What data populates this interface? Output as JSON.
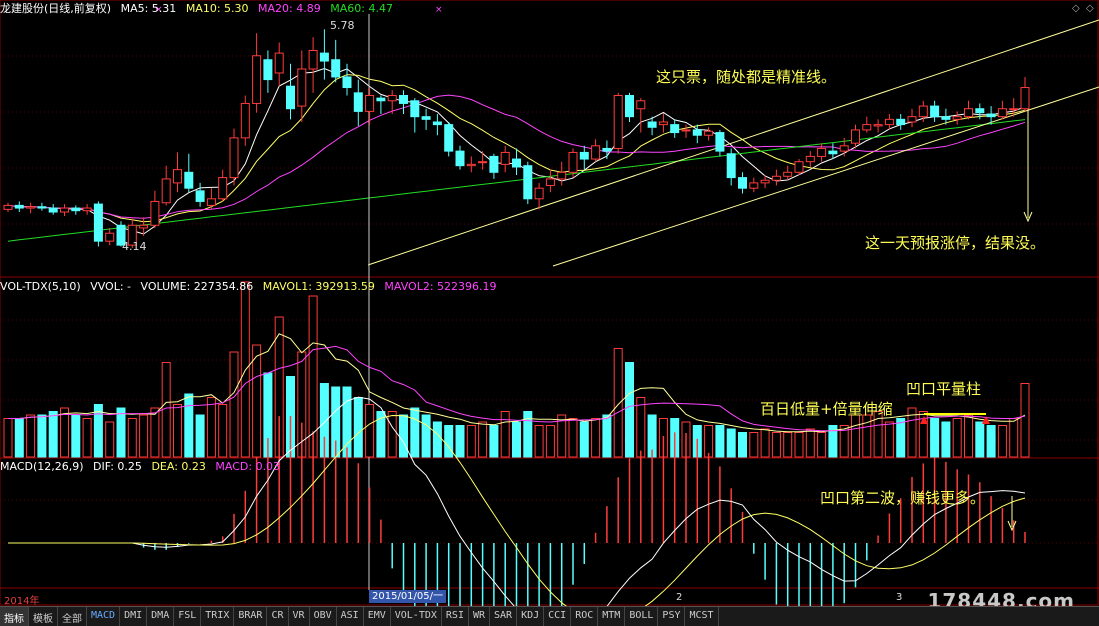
{
  "header": {
    "title": "龙建股份(日线,前复权)",
    "ma5": "MA5: 5.31",
    "ma10": "MA10: 5.30",
    "ma20": "MA20: 4.89",
    "ma60": "MA60: 4.47"
  },
  "volume_header": {
    "name": "VOL-TDX(5,10)",
    "vvol": "VVOL: -",
    "volume": "VOLUME: 227354.86",
    "mavol1": "MAVOL1: 392913.59",
    "mavol2": "MAVOL2: 522396.19"
  },
  "macd_header": {
    "name": "MACD(12,26,9)",
    "dif": "DIF: 0.25",
    "dea": "DEA: 0.23",
    "macd": "MACD: 0.03"
  },
  "annotations": {
    "note1": "这只票，随处都是精准线。",
    "note2": "这一天预报涨停，结果没。",
    "note3": "百日低量+倍量伸缩",
    "note4": "凹口平量柱",
    "note5": "凹口第二波，赚钱更多。",
    "high_label": "5.78",
    "low_label": "4.14"
  },
  "timeline": {
    "year": "2014年",
    "cursor_date": "2015/01/05/一",
    "m2": "2",
    "m3": "3"
  },
  "watermark": "178448.com",
  "tabs": [
    "指标",
    "模板",
    "全部",
    "MACD",
    "DMI",
    "DMA",
    "FSL",
    "TRIX",
    "BRAR",
    "CR",
    "VR",
    "OBV",
    "ASI",
    "EMV",
    "VOL-TDX",
    "RSI",
    "WR",
    "SAR",
    "KDJ",
    "CCI",
    "ROC",
    "MTM",
    "BOLL",
    "PSY",
    "MCST"
  ],
  "colors": {
    "up": "#ff3c3c",
    "down": "#54ffff",
    "ma5": "#ffffff",
    "ma10": "#ffff66",
    "ma20": "#ff44ff",
    "ma60": "#22dd22",
    "trendline": "#ffff99"
  },
  "chart_data": {
    "type": "candlestick",
    "units": "price (CNY)",
    "candles": [
      [
        4.42,
        4.45,
        4.47,
        4.4
      ],
      [
        4.45,
        4.43,
        4.48,
        4.4
      ],
      [
        4.43,
        4.44,
        4.47,
        4.39
      ],
      [
        4.44,
        4.43,
        4.47,
        4.41
      ],
      [
        4.43,
        4.4,
        4.46,
        4.38
      ],
      [
        4.4,
        4.43,
        4.46,
        4.37
      ],
      [
        4.43,
        4.41,
        4.45,
        4.38
      ],
      [
        4.41,
        4.43,
        4.46,
        4.38
      ],
      [
        4.46,
        4.18,
        4.48,
        4.14
      ],
      [
        4.18,
        4.24,
        4.28,
        4.15
      ],
      [
        4.3,
        4.15,
        4.33,
        4.14
      ],
      [
        4.15,
        4.3,
        4.35,
        4.13
      ],
      [
        4.28,
        4.3,
        4.36,
        4.22
      ],
      [
        4.3,
        4.48,
        4.56,
        4.28
      ],
      [
        4.47,
        4.65,
        4.75,
        4.45
      ],
      [
        4.62,
        4.72,
        4.85,
        4.55
      ],
      [
        4.7,
        4.58,
        4.84,
        4.55
      ],
      [
        4.56,
        4.48,
        4.62,
        4.44
      ],
      [
        4.45,
        4.5,
        4.58,
        4.42
      ],
      [
        4.5,
        4.66,
        4.72,
        4.48
      ],
      [
        4.66,
        4.96,
        5.03,
        4.6
      ],
      [
        4.96,
        5.22,
        5.28,
        4.9
      ],
      [
        5.22,
        5.58,
        5.75,
        5.15
      ],
      [
        5.55,
        5.4,
        5.62,
        5.3
      ],
      [
        5.45,
        5.6,
        5.68,
        5.35
      ],
      [
        5.35,
        5.18,
        5.52,
        5.1
      ],
      [
        5.2,
        5.48,
        5.62,
        5.08
      ],
      [
        5.48,
        5.62,
        5.72,
        5.3
      ],
      [
        5.6,
        5.54,
        5.78,
        5.4
      ],
      [
        5.55,
        5.42,
        5.7,
        5.38
      ],
      [
        5.42,
        5.34,
        5.52,
        5.28
      ],
      [
        5.3,
        5.16,
        5.4,
        5.05
      ],
      [
        5.16,
        5.28,
        5.34,
        5.06
      ],
      [
        5.26,
        5.24,
        5.28,
        5.14
      ],
      [
        5.24,
        5.28,
        5.32,
        5.14
      ],
      [
        5.28,
        5.22,
        5.32,
        5.14
      ],
      [
        5.24,
        5.12,
        5.26,
        5.0
      ],
      [
        5.12,
        5.1,
        5.18,
        5.02
      ],
      [
        5.08,
        5.06,
        5.14,
        4.98
      ],
      [
        5.06,
        4.86,
        5.08,
        4.82
      ],
      [
        4.86,
        4.75,
        4.9,
        4.72
      ],
      [
        4.75,
        4.76,
        4.82,
        4.7
      ],
      [
        4.78,
        4.78,
        4.86,
        4.72
      ],
      [
        4.82,
        4.7,
        4.84,
        4.65
      ],
      [
        4.76,
        4.85,
        4.9,
        4.7
      ],
      [
        4.8,
        4.74,
        4.88,
        4.68
      ],
      [
        4.75,
        4.5,
        4.78,
        4.46
      ],
      [
        4.5,
        4.58,
        4.62,
        4.42
      ],
      [
        4.6,
        4.65,
        4.72,
        4.55
      ],
      [
        4.65,
        4.7,
        4.78,
        4.6
      ],
      [
        4.7,
        4.85,
        4.88,
        4.66
      ],
      [
        4.85,
        4.8,
        4.9,
        4.72
      ],
      [
        4.8,
        4.9,
        4.95,
        4.78
      ],
      [
        4.88,
        4.86,
        4.94,
        4.8
      ],
      [
        4.88,
        5.28,
        5.3,
        4.84
      ],
      [
        5.28,
        5.12,
        5.3,
        5.08
      ],
      [
        5.18,
        5.24,
        5.26,
        5.0
      ],
      [
        5.08,
        5.04,
        5.12,
        4.98
      ],
      [
        5.06,
        5.08,
        5.14,
        5.0
      ],
      [
        5.06,
        5.0,
        5.1,
        4.96
      ],
      [
        5.02,
        5.02,
        5.06,
        4.96
      ],
      [
        5.02,
        4.98,
        5.06,
        4.92
      ],
      [
        4.98,
        5.01,
        5.04,
        4.94
      ],
      [
        5.0,
        4.86,
        5.02,
        4.82
      ],
      [
        4.84,
        4.66,
        4.88,
        4.6
      ],
      [
        4.66,
        4.58,
        4.7,
        4.54
      ],
      [
        4.58,
        4.62,
        4.66,
        4.55
      ],
      [
        4.62,
        4.64,
        4.68,
        4.58
      ],
      [
        4.64,
        4.67,
        4.72,
        4.6
      ],
      [
        4.67,
        4.7,
        4.75,
        4.64
      ],
      [
        4.7,
        4.78,
        4.8,
        4.68
      ],
      [
        4.78,
        4.82,
        4.86,
        4.74
      ],
      [
        4.82,
        4.88,
        4.92,
        4.78
      ],
      [
        4.86,
        4.84,
        4.92,
        4.8
      ],
      [
        4.86,
        4.9,
        4.96,
        4.82
      ],
      [
        4.92,
        5.02,
        5.06,
        4.88
      ],
      [
        5.02,
        5.06,
        5.12,
        5.0
      ],
      [
        5.05,
        5.06,
        5.1,
        5.0
      ],
      [
        5.06,
        5.1,
        5.14,
        5.02
      ],
      [
        5.1,
        5.06,
        5.14,
        5.02
      ],
      [
        5.08,
        5.12,
        5.18,
        5.04
      ],
      [
        5.12,
        5.2,
        5.24,
        5.08
      ],
      [
        5.2,
        5.12,
        5.24,
        5.08
      ],
      [
        5.12,
        5.1,
        5.18,
        5.06
      ],
      [
        5.1,
        5.12,
        5.16,
        5.06
      ],
      [
        5.12,
        5.18,
        5.24,
        5.1
      ],
      [
        5.18,
        5.15,
        5.22,
        5.1
      ],
      [
        5.14,
        5.12,
        5.2,
        5.06
      ],
      [
        5.12,
        5.18,
        5.24,
        5.1
      ],
      [
        5.18,
        5.18,
        5.26,
        5.12
      ],
      [
        5.18,
        5.34,
        5.42,
        5.16
      ]
    ],
    "volume": [
      0.22,
      0.22,
      0.24,
      0.24,
      0.26,
      0.28,
      0.24,
      0.22,
      0.3,
      0.2,
      0.28,
      0.22,
      0.24,
      0.28,
      0.54,
      0.3,
      0.36,
      0.24,
      0.34,
      0.3,
      0.6,
      1.0,
      0.64,
      0.48,
      0.8,
      0.46,
      0.6,
      0.92,
      0.42,
      0.4,
      0.4,
      0.34,
      0.3,
      0.26,
      0.26,
      0.24,
      0.28,
      0.24,
      0.2,
      0.18,
      0.18,
      0.18,
      0.2,
      0.18,
      0.26,
      0.2,
      0.26,
      0.18,
      0.18,
      0.24,
      0.22,
      0.2,
      0.22,
      0.24,
      0.62,
      0.54,
      0.34,
      0.24,
      0.22,
      0.22,
      0.2,
      0.18,
      0.18,
      0.18,
      0.16,
      0.14,
      0.14,
      0.16,
      0.14,
      0.14,
      0.14,
      0.16,
      0.14,
      0.18,
      0.18,
      0.24,
      0.24,
      0.26,
      0.2,
      0.22,
      0.28,
      0.26,
      0.22,
      0.2,
      0.22,
      0.24,
      0.2,
      0.18,
      0.18,
      0.22,
      0.42
    ],
    "macd_dif": null,
    "price_range": [
      4.0,
      5.85
    ]
  }
}
